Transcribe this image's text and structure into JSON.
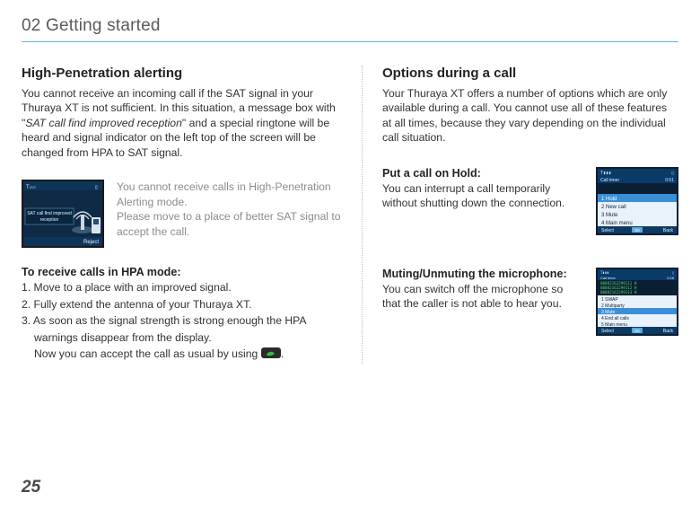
{
  "chapter": "02 Getting started",
  "page_number": "25",
  "left": {
    "heading": "High-Penetration alerting",
    "p1a": "You cannot receive an incoming call if the SAT signal in your Thuraya XT is not sufficient. In this situation, a message box with \"",
    "p1_italic": "SAT call find improved reception",
    "p1b": "\" and a special ringtone will be heard and signal indicator on the left top of the screen will be changed from HPA to SAT signal.",
    "note_l1": "You cannot receive calls in High-Penetration Alerting mode.",
    "note_l2": "Please move to a place of better SAT signal to accept the call.",
    "hpa_heading": "To receive calls in HPA mode:",
    "step1": "1. Move to a place with an improved signal.",
    "step2": "2. Fully extend the antenna of your Thuraya XT.",
    "step3a": "3. As soon as the signal strength is strong enough the HPA",
    "step3b": "warnings disappear from the display.",
    "step3c_a": "Now you can accept the call as usual by using ",
    "step3c_b": ".",
    "screenshot": {
      "status_left": "T▱▱",
      "status_right": "▯",
      "line1": "SAT call find improved",
      "line2": "reception",
      "softkey_right": "Reject"
    }
  },
  "right": {
    "heading": "Options during a call",
    "intro": "Your Thuraya XT offers a number of options which are only available during a call. You cannot use all of these features at all times, because they vary depending on the individual call situation.",
    "hold": {
      "title": "Put a call on Hold:",
      "body": "You can interrupt a call temporarily without shutting down the connection."
    },
    "mute": {
      "title": "Muting/Unmuting the microphone:",
      "body": "You can switch off the microphone so that the caller is not able to hear you."
    },
    "shot_hold": {
      "status_left": "T▮▮▮",
      "status_right": "▯",
      "timer_label": "Call timer",
      "timer_val": "0:01",
      "m1": "1 Hold",
      "m2": "2 New call",
      "m3": "3 Mute",
      "m4": "4 Main menu",
      "sk_left": "Select",
      "sk_mid": "OK",
      "sk_right": "Back"
    },
    "shot_mute": {
      "status_left": "T▮▮▮",
      "status_right": "▯",
      "timer_label": "Call timer",
      "timer_val": "0:28",
      "n1": "00882162299111    H",
      "n2": "00882162299112    H",
      "n3": "00882162299113    H",
      "m1": "1 SWAP",
      "m2": "2 Multiparty",
      "m3": "3 Mute",
      "m4": "4 End all calls",
      "m5": "5 Main menu",
      "sk_left": "Select",
      "sk_mid": "OK",
      "sk_right": "Back"
    }
  }
}
